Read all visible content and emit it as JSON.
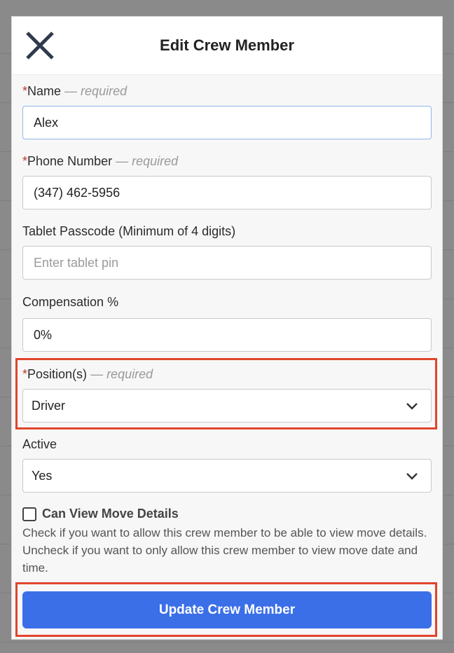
{
  "modal": {
    "title": "Edit Crew Member",
    "close_icon": "close-icon"
  },
  "fields": {
    "required_note": "— required",
    "required_marker": "*",
    "name": {
      "label": "Name",
      "value": "Alex"
    },
    "phone": {
      "label": "Phone Number",
      "value": "(347) 462-5956"
    },
    "tablet_passcode": {
      "label": "Tablet Passcode (Minimum of 4 digits)",
      "value": "",
      "placeholder": "Enter tablet pin"
    },
    "compensation": {
      "label": "Compensation %",
      "value": "0%"
    },
    "positions": {
      "label": "Position(s)",
      "selected": "Driver",
      "icon": "chevron-down-icon"
    },
    "active": {
      "label": "Active",
      "selected": "Yes",
      "icon": "chevron-down-icon"
    }
  },
  "view_details": {
    "label": "Can View Move Details",
    "checked": false,
    "help": "Check if you want to allow this crew member to be able to view move details. Uncheck if you want to only allow this crew member to view move date and time."
  },
  "submit": {
    "label": "Update Crew Member"
  },
  "colors": {
    "primary": "#3b6fe8",
    "highlight": "#e0452c",
    "required": "#c0392b"
  }
}
